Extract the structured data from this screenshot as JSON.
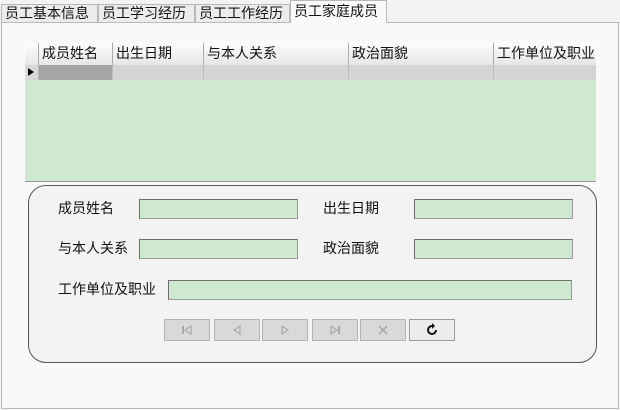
{
  "tabs": [
    {
      "label": "员工基本信息"
    },
    {
      "label": "员工学习经历"
    },
    {
      "label": "员工工作经历"
    },
    {
      "label": "员工家庭成员",
      "active": true
    }
  ],
  "grid": {
    "columns": [
      "成员姓名",
      "出生日期",
      "与本人关系",
      "政治面貌",
      "工作单位及职业"
    ],
    "rows": [
      [
        "",
        "",
        "",
        "",
        ""
      ]
    ]
  },
  "form": {
    "name_label": "成员姓名",
    "name_value": "",
    "birth_label": "出生日期",
    "birth_value": "",
    "relation_label": "与本人关系",
    "relation_value": "",
    "political_label": "政治面貌",
    "political_value": "",
    "work_label": "工作单位及职业",
    "work_value": ""
  },
  "navigator": {
    "buttons": [
      {
        "icon": "first-record-icon",
        "enabled": false
      },
      {
        "icon": "prior-record-icon",
        "enabled": false
      },
      {
        "icon": "next-record-icon",
        "enabled": false
      },
      {
        "icon": "last-record-icon",
        "enabled": false
      },
      {
        "icon": "cancel-edit-icon",
        "enabled": false
      },
      {
        "icon": "refresh-icon",
        "enabled": true
      }
    ]
  },
  "colors": {
    "field_bg": "#cfe8d0",
    "grid_bg": "#cfe8d0",
    "selected_cell": "#a5a5a5"
  }
}
